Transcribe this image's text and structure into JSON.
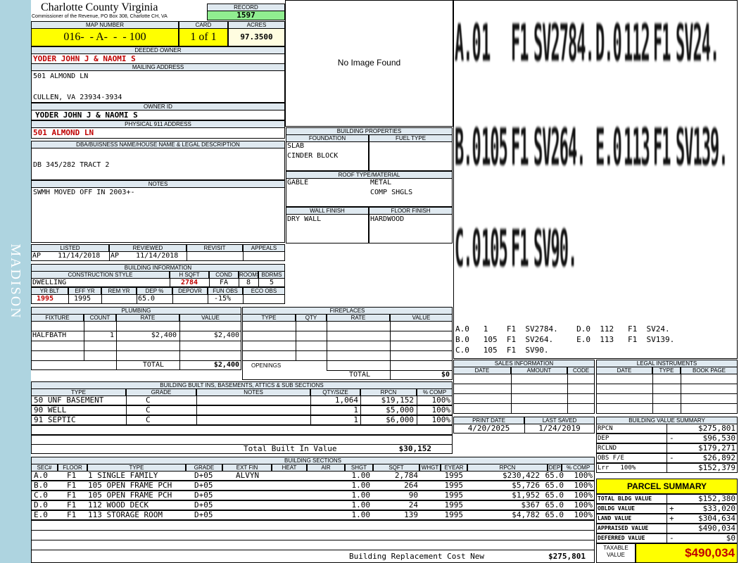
{
  "sidebar": {
    "text": "MADISON"
  },
  "header": {
    "county": "Charlotte County Virginia",
    "commissioner": "Commissioner of the Revenue, PO Box 308, Charlotte CH, VA",
    "record_label": "RECORD",
    "record": "1597",
    "map_label": "MAP NUMBER",
    "map_number": "016-  - A-  -  - 100",
    "card_label": "CARD",
    "card": "1 of 1",
    "acres_label": "ACRES",
    "acres": "97.3500"
  },
  "owner": {
    "deeded_label": "DEEDED OWNER",
    "deeded": "YODER JOHN J & NAOMI S",
    "mailing_label": "MAILING ADDRESS",
    "mailing1": "501 ALMOND LN",
    "mailing2": "CULLEN, VA 23934-3934",
    "owner_id_label": "OWNER ID",
    "owner_id": "YODER JOHN J & NAOMI S",
    "physical_label": "PHYSICAL 911 ADDRESS",
    "physical": "501 ALMOND LN"
  },
  "legal": {
    "label": "DBA/BUISNESS NAME/HOUSE NAME & LEGAL DESCRIPTION",
    "text": "DB 345/282 TRACT 2"
  },
  "notes": {
    "label": "NOTES",
    "text": "SWMH MOVED OFF IN 2003+-"
  },
  "image": {
    "text": "No Image Found"
  },
  "building_props": {
    "label": "BUILDING PROPERTIES",
    "foundation_label": "FOUNDATION",
    "fuel_label": "FUEL TYPE",
    "foundation1": "SLAB",
    "foundation2": "CINDER BLOCK",
    "roof_label": "ROOF TYPE/MATERIAL",
    "roof1": "GABLE",
    "roof2": "METAL",
    "roof3": "COMP SHGLS",
    "wall_label": "WALL FINISH",
    "floor_label": "FLOOR FINISH",
    "wall": "DRY WALL",
    "floor": "HARDWOOD"
  },
  "sketch": {
    "big": [
      [
        "A.0",
        "1",
        "F1",
        "SV2784.",
        "D.0",
        "112",
        "F1",
        "SV24."
      ],
      [
        "B.0",
        "105",
        "F1",
        "SV264.",
        "E.0",
        "113",
        "F1",
        "SV139."
      ],
      [
        "C.0",
        "105",
        "F1",
        "SV90."
      ]
    ],
    "line1": "A.0   1    F1  SV2784.    D.0  112   F1  SV24.",
    "line2": "B.0   105  F1  SV264.     E.0  113   F1  SV139.",
    "line3": "C.0   105  F1  SV90."
  },
  "review": {
    "listed_label": "LISTED",
    "reviewed_label": "REVIEWED",
    "revisit_label": "REVISIT",
    "appeals_label": "APPEALS",
    "listed": "AP    11/14/2018",
    "reviewed": "AP    11/14/2018"
  },
  "building_info": {
    "label": "BUILDING INFORMATION",
    "cs_label": "CONSTRUCTION STYLE",
    "hsqft_label": "H SQFT",
    "cond_label": "COND",
    "rooms_label": "ROOMS",
    "bdrms_label": "BDRMS",
    "style": "DWELLING",
    "hsqft": "2784",
    "cond": "FA",
    "rooms": "8",
    "bdrms": "5",
    "yrblt_label": "YR BLT",
    "effyr_label": "EFF YR",
    "remyr_label": "REM YR",
    "dep_label": "DEP %",
    "depovr_label": "DEPOVR",
    "funobs_label": "FUN OBS",
    "ecoobs_label": "ECO OBS",
    "yrblt": "1995",
    "effyr": "1995",
    "dep": "65.0",
    "funobs": "-15%"
  },
  "plumbing": {
    "label": "PLUMBING",
    "fixture_label": "FIXTURE",
    "count_label": "COUNT",
    "rate_label": "RATE",
    "value_label": "VALUE",
    "fixture": "HALFBATH",
    "count": "1",
    "rate": "$2,400",
    "value": "$2,400",
    "total_label": "TOTAL",
    "total": "$2,400"
  },
  "fireplaces": {
    "label": "FIREPLACES",
    "type_label": "TYPE",
    "qty_label": "QTY",
    "rate_label": "RATE",
    "value_label": "VALUE",
    "openings_label": "OPENINGS",
    "total_label": "TOTAL",
    "total": "$0"
  },
  "sales": {
    "label": "SALES INFORMATION",
    "date_label": "DATE",
    "amount_label": "AMOUNT",
    "code_label": "CODE"
  },
  "legal_instr": {
    "label": "LEGAL INSTRUMENTS",
    "date_label": "DATE",
    "type_label": "TYPE",
    "book_label": "BOOK PAGE"
  },
  "builtins": {
    "label": "BUILDING BUILT INS, BASEMENTS, ATTICS & SUB SECTIONS",
    "headers": [
      "TYPE",
      "GRADE",
      "NOTES",
      "QTY/SIZE",
      "RPCN",
      "% COMP"
    ],
    "rows": [
      [
        "50 UNF BASEMENT",
        "C",
        "",
        "1,064",
        "$19,152",
        "100%"
      ],
      [
        "90 WELL",
        "C",
        "",
        "1",
        "$5,000",
        "100%"
      ],
      [
        "91 SEPTIC",
        "C",
        "",
        "1",
        "$6,000",
        "100%"
      ]
    ],
    "total_label": "Total Built In Value",
    "total": "$30,152"
  },
  "dates": {
    "print_label": "PRINT DATE",
    "saved_label": "LAST SAVED",
    "print": "4/20/2025",
    "saved": "1/24/2019"
  },
  "bvs": {
    "label": "BUILDING VALUE SUMMARY",
    "rows": [
      [
        "RPCN",
        "",
        "$275,801"
      ],
      [
        "DEP",
        "-",
        "$96,530"
      ],
      [
        "RCLND",
        "",
        "$179,271"
      ],
      [
        "OBS F/E",
        "-",
        "$26,892"
      ],
      [
        "Lrr   100%",
        "",
        "$152,379"
      ]
    ]
  },
  "sections": {
    "label": "BUILDING SECTIONS",
    "headers": [
      "SEC#",
      "FLOOR",
      "TYPE",
      "GRADE",
      "EXT FIN",
      "HEAT",
      "AIR",
      "SHGT",
      "SQFT",
      "WHGT",
      "EYEAR",
      "RPCN",
      "DEP",
      "% COMP"
    ],
    "rows": [
      [
        "A.0",
        "F1",
        "1 SINGLE FAMILY",
        "D+05",
        "ALVYN",
        "",
        "",
        "1.00",
        "2,784",
        "",
        "1995",
        "$230,422",
        "65.0",
        "100%"
      ],
      [
        "B.0",
        "F1",
        "105 OPEN FRAME PCH",
        "D+05",
        "",
        "",
        "",
        "1.00",
        "264",
        "",
        "1995",
        "$5,726",
        "65.0",
        "100%"
      ],
      [
        "C.0",
        "F1",
        "105 OPEN FRAME PCH",
        "D+05",
        "",
        "",
        "",
        "1.00",
        "90",
        "",
        "1995",
        "$1,952",
        "65.0",
        "100%"
      ],
      [
        "D.0",
        "F1",
        "112 WOOD DECK",
        "D+05",
        "",
        "",
        "",
        "1.00",
        "24",
        "",
        "1995",
        "$367",
        "65.0",
        "100%"
      ],
      [
        "E.0",
        "F1",
        "113 STORAGE ROOM",
        "D+05",
        "",
        "",
        "",
        "1.00",
        "139",
        "",
        "1995",
        "$4,782",
        "65.0",
        "100%"
      ]
    ],
    "brcn_label": "Building Replacement Cost New",
    "brcn": "$275,801"
  },
  "parcel": {
    "label": "PARCEL SUMMARY",
    "rows": [
      [
        "TOTAL BLDG VALUE",
        "",
        "$152,380"
      ],
      [
        "OBLDG VALUE",
        "+",
        "$33,020"
      ],
      [
        "LAND VALUE",
        "+",
        "$304,634"
      ],
      [
        "APPRAISED VALUE",
        "",
        "$490,034"
      ],
      [
        "DEFERRED VALUE",
        "-",
        "$0"
      ]
    ],
    "taxable_label1": "TAXABLE",
    "taxable_label2": "VALUE",
    "taxable": "$490,034"
  },
  "colors": {
    "sidebar": "#aed4e0",
    "header_bg": "#dfe9f0",
    "yellow": "#ffff00",
    "record_green": "#90ee90",
    "acres_bg": "#fffde0",
    "red": "#c00000"
  }
}
